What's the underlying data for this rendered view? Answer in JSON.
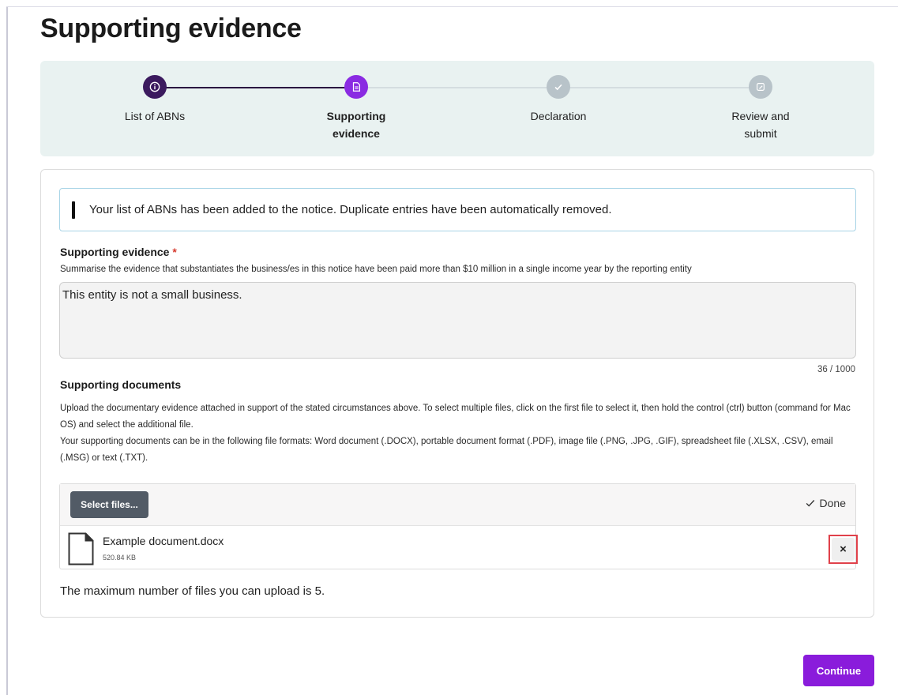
{
  "page": {
    "title": "Supporting evidence"
  },
  "stepper": {
    "steps": [
      {
        "label": "List of ABNs",
        "icon": "info-icon",
        "state": "completed"
      },
      {
        "label": "Supporting evidence",
        "icon": "document-icon",
        "state": "active"
      },
      {
        "label": "Declaration",
        "icon": "check-icon",
        "state": "upcoming"
      },
      {
        "label": "Review and submit",
        "icon": "edit-icon",
        "state": "upcoming"
      }
    ],
    "colors": {
      "completed": "#3b1a5e",
      "active": "#8a2be2",
      "upcoming": "#b8c3c9"
    }
  },
  "alert": {
    "message": "Your list of ABNs has been added to the notice. Duplicate entries have been automatically removed."
  },
  "evidence": {
    "label": "Supporting evidence",
    "required_mark": "*",
    "hint": "Summarise the evidence that substantiates the business/es in this notice have been paid more than $10 million in a single income year by the reporting entity",
    "value": "This entity is not a small business.",
    "counter": "36 / 1000"
  },
  "documents": {
    "label": "Supporting documents",
    "description_1": "Upload the documentary evidence attached in support of the stated circumstances above. To select multiple files, click on the first file to select it, then hold the control (ctrl) button (command for Mac OS) and select the additional file.",
    "description_2": "Your supporting documents can be in the following file formats: Word document (.DOCX), portable document format (.PDF), image file (.PNG, .JPG, .GIF), spreadsheet file (.XLSX, .CSV), email (.MSG) or text (.TXT).",
    "select_label": "Select files...",
    "status": "Done",
    "files": [
      {
        "name": "Example document.docx",
        "size": "520.84 KB"
      }
    ],
    "remove_label": "×",
    "max_note": "The maximum number of files you can upload is 5."
  },
  "actions": {
    "continue_label": "Continue",
    "accent": "#8a1cdb"
  }
}
